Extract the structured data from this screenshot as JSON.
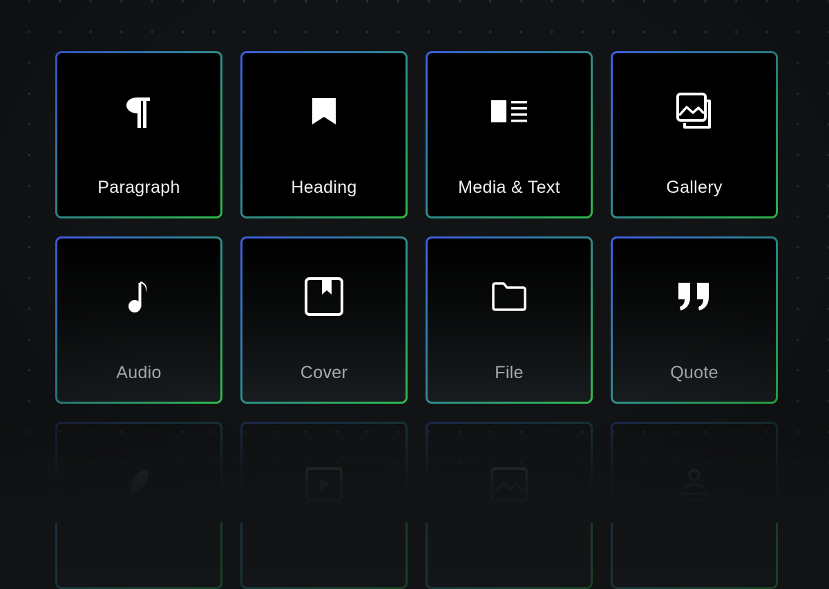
{
  "colors": {
    "background": "#111315",
    "tile_fill": "#000000",
    "border_start": "#3d5ee0",
    "border_mid": "#2f8a8a",
    "border_end": "#2eb84a",
    "label_primary": "#f2f2f2",
    "label_secondary": "#a7abb0"
  },
  "blocks": [
    {
      "label": "Paragraph",
      "icon": "paragraph-icon"
    },
    {
      "label": "Heading",
      "icon": "bookmark-icon"
    },
    {
      "label": "Media & Text",
      "icon": "media-text-icon"
    },
    {
      "label": "Gallery",
      "icon": "gallery-icon"
    },
    {
      "label": "Audio",
      "icon": "music-note-icon"
    },
    {
      "label": "Cover",
      "icon": "cover-icon"
    },
    {
      "label": "File",
      "icon": "folder-icon"
    },
    {
      "label": "Quote",
      "icon": "quote-icon"
    },
    {
      "label": "",
      "icon": "feather-icon"
    },
    {
      "label": "",
      "icon": "video-icon"
    },
    {
      "label": "",
      "icon": "image-icon"
    },
    {
      "label": "",
      "icon": "person-icon"
    }
  ]
}
